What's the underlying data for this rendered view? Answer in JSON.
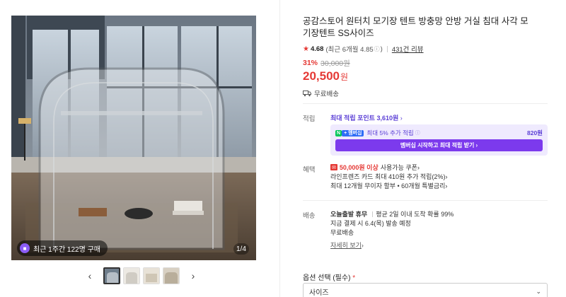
{
  "gallery": {
    "sales_badge": "최근 1주간 122명 구매",
    "page_counter": "1/4",
    "prev_arrow": "‹",
    "next_arrow": "›",
    "thumbnails": [
      "thumb-1",
      "thumb-2",
      "thumb-3",
      "thumb-4"
    ]
  },
  "product": {
    "title": "공감스토어 원터치 모기장 텐트 방충망 안방 거실 침대 사각 모기장텐트 SS사이즈",
    "rating": "4.68",
    "rating_recent": "(최근 6개월 4.85",
    "review_count": "431건 리뷰",
    "discount": "31%",
    "original_price": "30,000원",
    "price": "20,500",
    "currency": "원",
    "shipping": "무료배송"
  },
  "points": {
    "label": "적립",
    "title": "최대 적립 포인트 3,610원",
    "n_badge": "N",
    "plus_badge": "+ 멤버십",
    "members_text": "최대 5% 추가 적립",
    "members_points": "820원",
    "members_button": "멤버십 시작하고 최대 적립 받기 ›"
  },
  "benefits": {
    "label": "혜택",
    "coupon_tag": "쿠폰",
    "coupon_amount": "50,000원 이상",
    "coupon_text": "사용가능 쿠폰",
    "card_text": "라인프렌즈 카드 최대 410원 추가 적립(2%)",
    "installment_text": "최대 12개월 무이자 할부 • 60개월 특별금리"
  },
  "delivery": {
    "label": "배송",
    "today_title": "오늘출발 휴무",
    "today_text": "평균 2일 이내 도착 확률 99%",
    "eta_text": "지금 결제 시 6.4(목) 발송 예정",
    "free_text": "무료배송",
    "more_link": "자세히 보기"
  },
  "options": {
    "label": "옵션 선택 (필수)",
    "required_mark": "*",
    "select_value": "사이즈"
  },
  "colors": {
    "accent": "#e53935",
    "purple": "#5b3fd6",
    "naver_green": "#03c75a"
  }
}
